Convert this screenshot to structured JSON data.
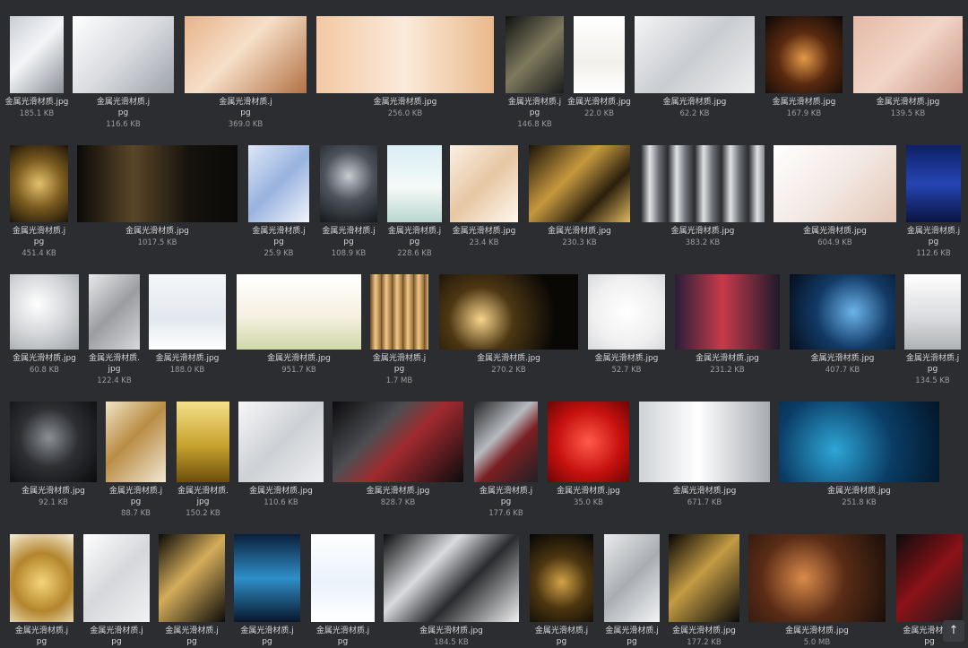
{
  "gallery": {
    "rows": [
      [
        {
          "filename": "金属光滑材质.jpg",
          "size": "185.1 KB",
          "bg": "linear-gradient(135deg,#c9ced4 0%,#f4f5f7 45%,#8a9097 100%)"
        },
        {
          "filename": "金属光滑材质.jpg",
          "size": "116.6 KB",
          "bg": "linear-gradient(135deg,#ffffff 0%,#d9dbdf 50%,#9ea3aa 100%)"
        },
        {
          "filename": "金属光滑材质.jpg",
          "size": "369.0 KB",
          "bg": "linear-gradient(135deg,#e7b48a 0%,#f7dfc9 45%,#b27144 100%)"
        },
        {
          "filename": "金属光滑材质.jpg",
          "size": "256.0 KB",
          "bg": "linear-gradient(90deg,#f2c9a3 0%,#fbeada 50%,#e9b98b 100%)"
        },
        {
          "filename": "金属光滑材质.jpg",
          "size": "146.8 KB",
          "bg": "linear-gradient(135deg,#0f1210 0%,#7e7a5e 50%,#1a1c1a 100%)"
        },
        {
          "filename": "金属光滑材质.jpg",
          "size": "22.0 KB",
          "bg": "linear-gradient(180deg,#ffffff 0%,#f2f0ea 60%,#ffffff 100%)"
        },
        {
          "filename": "金属光滑材质.jpg",
          "size": "62.2 KB",
          "bg": "linear-gradient(135deg,#f5f5f5 0%,#c9ccd1 50%,#eeeeee 100%)"
        },
        {
          "filename": "金属光滑材质.jpg",
          "size": "167.9 KB",
          "bg": "radial-gradient(circle at 50% 55%,#e39a47 0%,#5a2a10 45%,#0b0807 100%)"
        },
        {
          "filename": "金属光滑材质.jpg",
          "size": "139.5 KB",
          "bg": "linear-gradient(135deg,#e6b9a6 0%,#f2d6c8 50%,#c99483 100%)"
        }
      ],
      [
        {
          "filename": "金属光滑材质.jpg",
          "size": "451.4 KB",
          "bg": "radial-gradient(circle at 50% 50%,#e2c16b 0%,#7a5a1e 50%,#1c150a 100%)"
        },
        {
          "filename": "金属光滑材质.jpg",
          "size": "1017.5 KB",
          "bg": "linear-gradient(90deg,#0b0a08 0%,#5a4628 35%,#15120d 70%,#0b0a08 100%)"
        },
        {
          "filename": "金属光滑材质.jpg",
          "size": "25.9 KB",
          "bg": "linear-gradient(135deg,#dde7f7 0%,#98b2df 50%,#f1f5fb 100%)"
        },
        {
          "filename": "金属光滑材质.jpg",
          "size": "108.9 KB",
          "bg": "radial-gradient(circle at 50% 40%,#c7ccd3 0%,#4d535c 45%,#15181c 100%)"
        },
        {
          "filename": "金属光滑材质.jpg",
          "size": "228.6 KB",
          "bg": "linear-gradient(180deg,#d9eef4 0%,#f5faf8 55%,#b9d6cf 100%)"
        },
        {
          "filename": "金属光滑材质.jpg",
          "size": "23.4 KB",
          "bg": "linear-gradient(135deg,#fbefe3 0%,#e7c7a4 50%,#fff7ee 100%)"
        },
        {
          "filename": "金属光滑材质.jpg",
          "size": "230.3 KB",
          "bg": "linear-gradient(135deg,#1a1308 0%,#c7993e 40%,#2b1f0d 70%,#e0b85e 100%)"
        },
        {
          "filename": "金属光滑材质.jpg",
          "size": "383.2 KB",
          "bg": "repeating-linear-gradient(90deg,#2a2b2e 0px,#e0e2e5 10px,#6d7076 20px,#2a2b2e 30px)"
        },
        {
          "filename": "金属光滑材质.jpg",
          "size": "604.9 KB",
          "bg": "linear-gradient(135deg,#ffffff 0%,#f3e9e4 50%,#e2c6b5 100%)"
        },
        {
          "filename": "金属光滑材质.jpg",
          "size": "112.6 KB",
          "bg": "linear-gradient(180deg,#0d1f66 0%,#2545b3 50%,#0a1540 100%)"
        }
      ],
      [
        {
          "filename": "金属光滑材质.jpg",
          "size": "60.8 KB",
          "bg": "radial-gradient(circle at 40% 40%,#ffffff 0%,#d3d5d8 50%,#9fa3a8 100%)"
        },
        {
          "filename": "金属光滑材质.jpg",
          "size": "122.4 KB",
          "bg": "linear-gradient(135deg,#e9e9ea 0%,#9b9da1 50%,#d7d8da 100%)"
        },
        {
          "filename": "金属光滑材质.jpg",
          "size": "188.0 KB",
          "bg": "linear-gradient(180deg,#f4f6f8 0%,#e3e8ee 60%,#ffffff 100%)"
        },
        {
          "filename": "金属光滑材质.jpg",
          "size": "951.7 KB",
          "bg": "linear-gradient(180deg,#ffffff 0%,#f6f1e2 55%,#cfd8a8 100%)"
        },
        {
          "filename": "金属光滑材质.jpg",
          "size": "1.7 MB",
          "bg": "repeating-linear-gradient(90deg,#6b4a1f 0px,#f0c98b 6px,#9a6c33 12px)"
        },
        {
          "filename": "金属光滑材质.jpg",
          "size": "270.2 KB",
          "bg": "radial-gradient(circle at 30% 60%,#f7d48c 0%,#4d3713 30%,#0a0805 70%)"
        },
        {
          "filename": "金属光滑材质.jpg",
          "size": "52.7 KB",
          "bg": "radial-gradient(circle at 50% 50%,#ffffff 0%,#f0f0f1 60%,#d9dadc 100%)"
        },
        {
          "filename": "金属光滑材质.jpg",
          "size": "231.2 KB",
          "bg": "linear-gradient(90deg,#2a1e3a 0%,#c73a4a 45%,#1d1a2c 100%)"
        },
        {
          "filename": "金属光滑材质.jpg",
          "size": "407.7 KB",
          "bg": "radial-gradient(circle at 60% 50%,#6bb3ea 0%,#123a66 50%,#050d1b 100%)"
        },
        {
          "filename": "金属光滑材质.jpg",
          "size": "134.5 KB",
          "bg": "linear-gradient(180deg,#ffffff 0%,#d9dadd 60%,#aeb1b6 100%)"
        }
      ],
      [
        {
          "filename": "金属光滑材质.jpg",
          "size": "92.1 KB",
          "bg": "radial-gradient(circle at 45% 45%,#8c8f94 0%,#2d2f33 45%,#0b0b0c 100%)"
        },
        {
          "filename": "金属光滑材质.jpg",
          "size": "88.7 KB",
          "bg": "linear-gradient(135deg,#f1e4c6 0%,#b98c44 45%,#f2e8d4 100%)"
        },
        {
          "filename": "金属光滑材质.jpg",
          "size": "150.2 KB",
          "bg": "linear-gradient(180deg,#f4e08a 0%,#c7a12d 55%,#6c4e0c 100%)"
        },
        {
          "filename": "金属光滑材质.jpg",
          "size": "110.6 KB",
          "bg": "linear-gradient(135deg,#f7f7f8 0%,#cdd0d4 50%,#eeeff1 100%)"
        },
        {
          "filename": "金属光滑材质.jpg",
          "size": "828.7 KB",
          "bg": "linear-gradient(135deg,#0b0b0c 0%,#4d4e52 35%,#a02a2f 55%,#0c0c0d 100%)"
        },
        {
          "filename": "金属光滑材质.jpg",
          "size": "177.6 KB",
          "bg": "linear-gradient(135deg,#26272a 0%,#b7babf 40%,#7a1f23 60%,#202124 100%)"
        },
        {
          "filename": "金属光滑材质.jpg",
          "size": "35.0 KB",
          "bg": "radial-gradient(circle at 50% 50%,#ff5a4a 0%,#c8120f 55%,#6d0606 100%)"
        },
        {
          "filename": "金属光滑材质.jpg",
          "size": "671.7 KB",
          "bg": "linear-gradient(90deg,#cfd2d6 0%,#ffffff 45%,#a7abb1 100%)"
        },
        {
          "filename": "金属光滑材质.jpg",
          "size": "251.8 KB",
          "bg": "radial-gradient(circle at 35% 60%,#2ea6d6 0%,#0a3d66 50%,#031526 100%)"
        }
      ],
      [
        {
          "filename": "金属光滑材质.jpg",
          "size": "",
          "bg": "radial-gradient(circle at 50% 55%,#f5d47a 0%,#b3852d 50%,#f7efd9 100%)"
        },
        {
          "filename": "金属光滑材质.jpg",
          "size": "",
          "bg": "linear-gradient(135deg,#ffffff 0%,#d5d7da 50%,#f1f2f3 100%)"
        },
        {
          "filename": "金属光滑材质.jpg",
          "size": "",
          "bg": "linear-gradient(135deg,#0b0a08 0%,#d4ad5a 45%,#0e0c09 100%)"
        },
        {
          "filename": "金属光滑材质.jpg",
          "size": "",
          "bg": "linear-gradient(180deg,#0a1f3a 0%,#2f8fc9 50%,#08172c 100%)"
        },
        {
          "filename": "金属光滑材质.jpg",
          "size": "",
          "bg": "linear-gradient(180deg,#ffffff 0%,#eaf2fb 55%,#ffffff 100%)"
        },
        {
          "filename": "金属光滑材质.jpg",
          "size": "184.5 KB",
          "bg": "linear-gradient(135deg,#0c0c0d 0%,#d9dbde 35%,#2a2b2e 60%,#f0f0f0 100%)"
        },
        {
          "filename": "金属光滑材质.jpg",
          "size": "",
          "bg": "radial-gradient(circle at 50% 55%,#d2a247 0%,#4c3610 45%,#050404 100%)"
        },
        {
          "filename": "金属光滑材质.jpg",
          "size": "",
          "bg": "linear-gradient(135deg,#e9eaec 0%,#a9adb2 50%,#f3f4f5 100%)"
        },
        {
          "filename": "金属光滑材质.jpg",
          "size": "177.2 KB",
          "bg": "linear-gradient(135deg,#050505 0%,#c39b43 45%,#0a0a0a 100%)"
        },
        {
          "filename": "金属光滑材质.jpg",
          "size": "5.0 MB",
          "bg": "radial-gradient(circle at 40% 50%,#d98a4b 0%,#5a2c16 45%,#1a0f0a 100%)"
        },
        {
          "filename": "金属光滑材质.jpg",
          "size": "",
          "bg": "linear-gradient(135deg,#0c0c0d 0%,#8b1218 50%,#1c1c1d 100%)"
        }
      ]
    ]
  },
  "ui": {
    "scroll_top_glyph": "↑"
  }
}
